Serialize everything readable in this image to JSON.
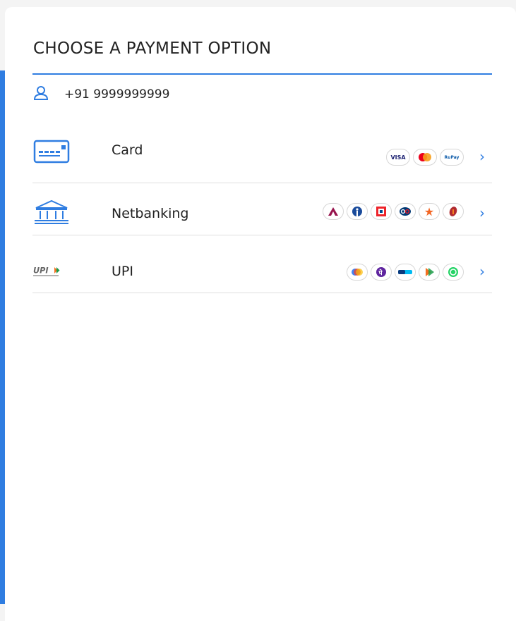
{
  "header": {
    "title": "CHOOSE A PAYMENT OPTION"
  },
  "user": {
    "phone": "+91 9999999999",
    "icon": "user-icon"
  },
  "colors": {
    "accent": "#2f7de1"
  },
  "options": [
    {
      "id": "card",
      "label": "Card",
      "icon": "credit-card-icon",
      "logos": [
        "VISA",
        "mastercard",
        "RuPay"
      ]
    },
    {
      "id": "netbanking",
      "label": "Netbanking",
      "icon": "bank-icon",
      "logos": [
        "axis-bank",
        "sbi",
        "hdfc-bank",
        "kotak",
        "icici-star",
        "icici-bank"
      ]
    },
    {
      "id": "upi",
      "label": "UPI",
      "icon": "upi-logo",
      "logos": [
        "google-pay",
        "phonepe",
        "paytm",
        "bhim",
        "whatsapp"
      ]
    }
  ]
}
